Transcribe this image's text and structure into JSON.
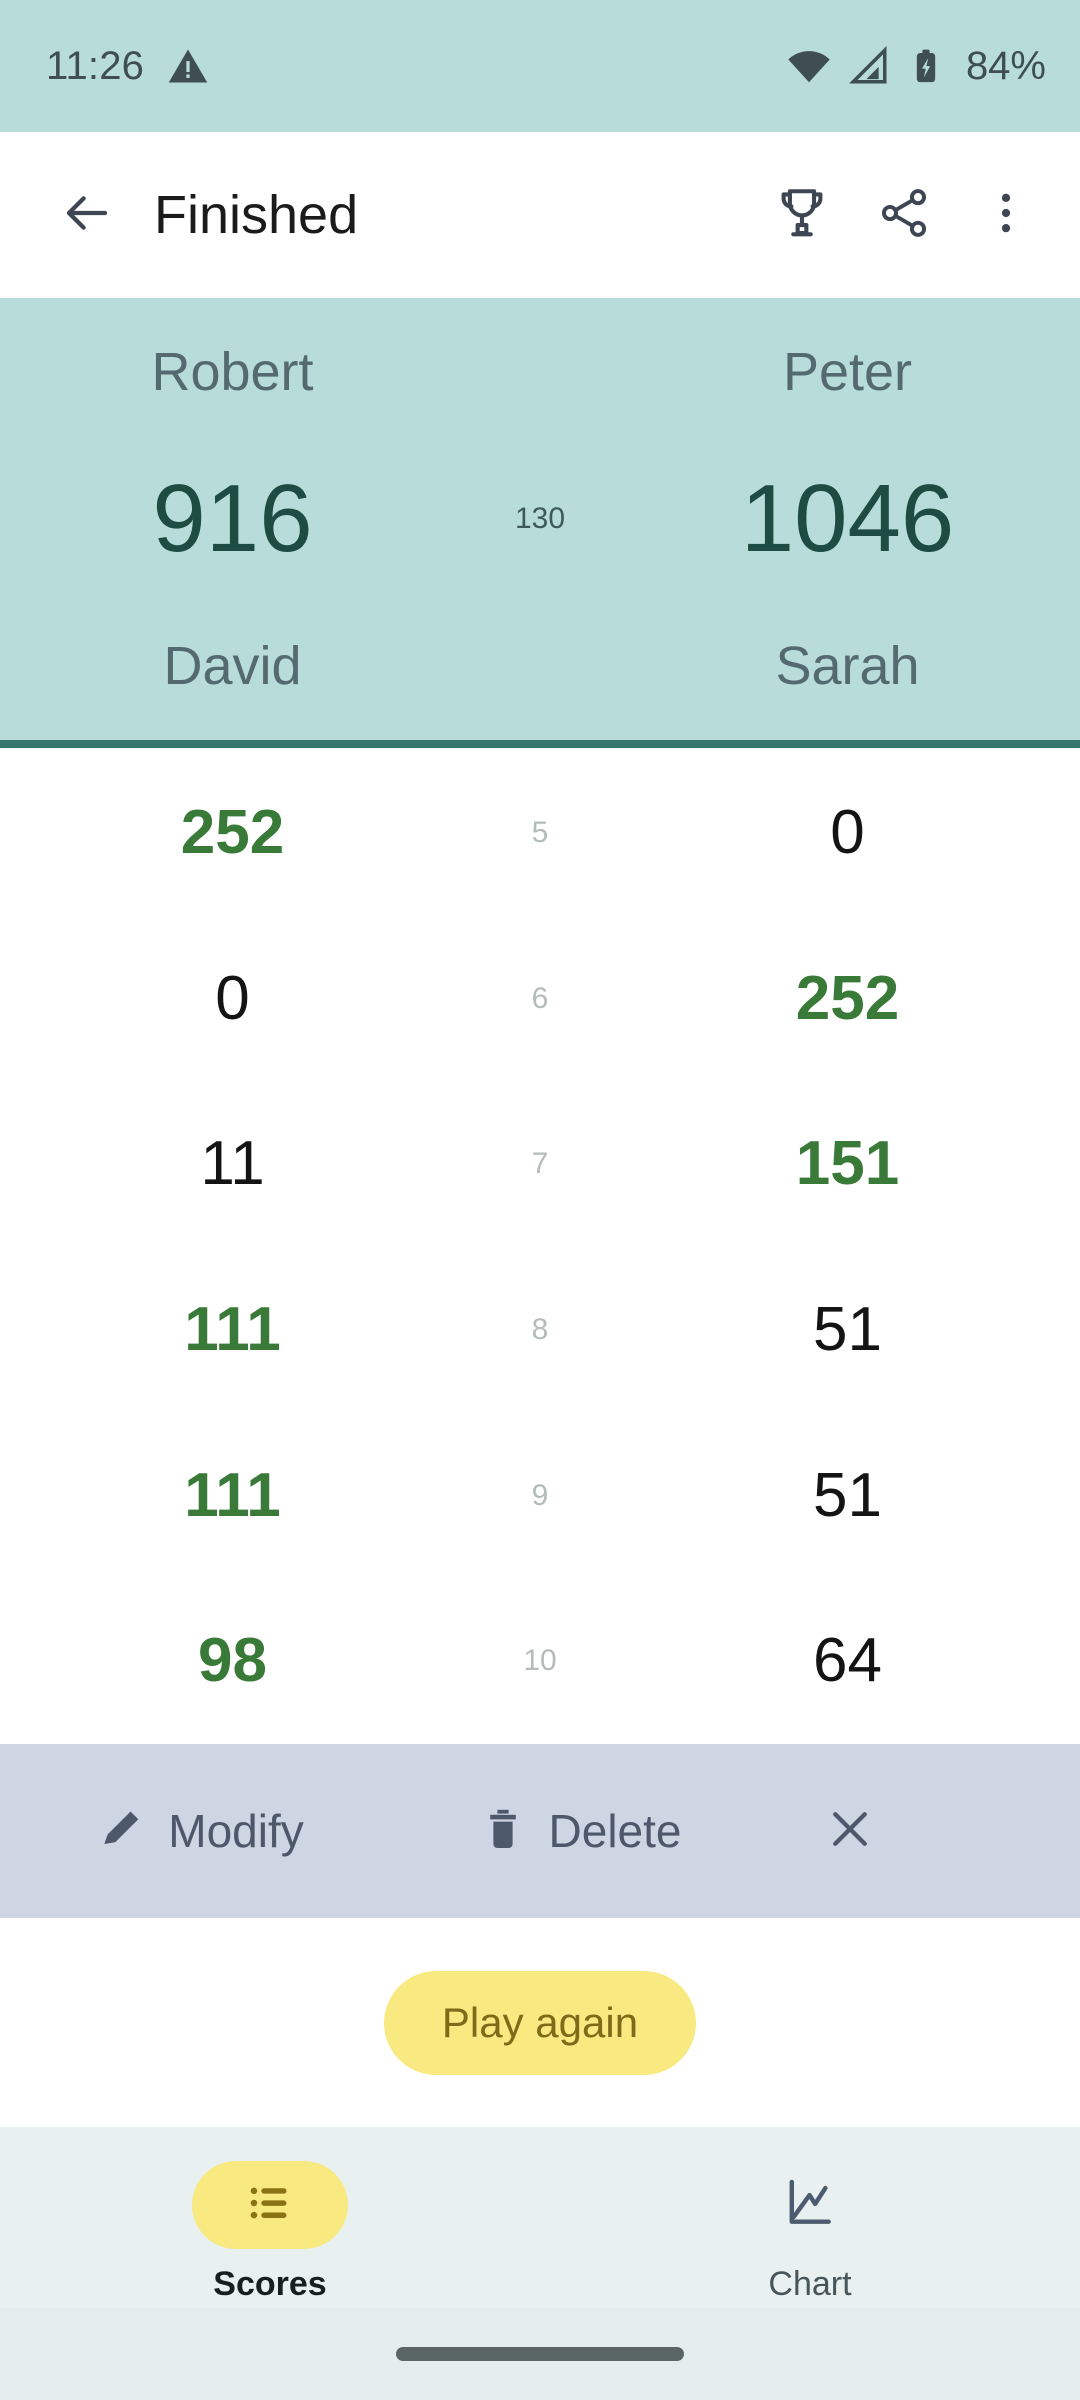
{
  "status_bar": {
    "time": "11:26",
    "warning_icon": "warning-triangle-icon",
    "wifi_icon": "wifi-icon",
    "signal_icon": "cell-signal-icon",
    "battery_icon": "battery-charging-icon",
    "battery_text": "84%"
  },
  "app_bar": {
    "back_icon": "back-arrow-icon",
    "title": "Finished",
    "trophy_icon": "trophy-icon",
    "share_icon": "share-icon",
    "overflow_icon": "more-vertical-icon"
  },
  "score_header": {
    "team_left": {
      "player_top": "Robert",
      "player_bottom": "David",
      "total": "916"
    },
    "team_right": {
      "player_top": "Peter",
      "player_bottom": "Sarah",
      "total": "1046"
    },
    "difference": "130"
  },
  "rounds": [
    {
      "number": "5",
      "left": "252",
      "right": "0",
      "left_win": true,
      "right_win": false
    },
    {
      "number": "6",
      "left": "0",
      "right": "252",
      "left_win": false,
      "right_win": true
    },
    {
      "number": "7",
      "left": "11",
      "right": "151",
      "left_win": false,
      "right_win": true
    },
    {
      "number": "8",
      "left": "111",
      "right": "51",
      "left_win": true,
      "right_win": false
    },
    {
      "number": "9",
      "left": "111",
      "right": "51",
      "left_win": true,
      "right_win": false
    },
    {
      "number": "10",
      "left": "98",
      "right": "64",
      "left_win": true,
      "right_win": false
    }
  ],
  "action_bar": {
    "modify_icon": "pencil-icon",
    "modify_label": "Modify",
    "delete_icon": "trash-icon",
    "delete_label": "Delete",
    "close_icon": "close-icon"
  },
  "play_again": {
    "label": "Play again"
  },
  "bottom_nav": {
    "items": [
      {
        "label": "Scores",
        "icon": "list-icon",
        "active": true
      },
      {
        "label": "Chart",
        "icon": "chart-icon",
        "active": false
      }
    ]
  },
  "colors": {
    "status_bar_bg": "#B7DCDA",
    "header_bg": "#B7DCDA",
    "header_divider": "#37766E",
    "total_score": "#1E4C42",
    "winning_score": "#3A7A38",
    "losing_score": "#141414",
    "round_number": "#B4BBBB",
    "action_bar_bg": "#CED5E3",
    "accent_yellow": "#F8E981",
    "nav_bg": "#E8F1F0"
  }
}
